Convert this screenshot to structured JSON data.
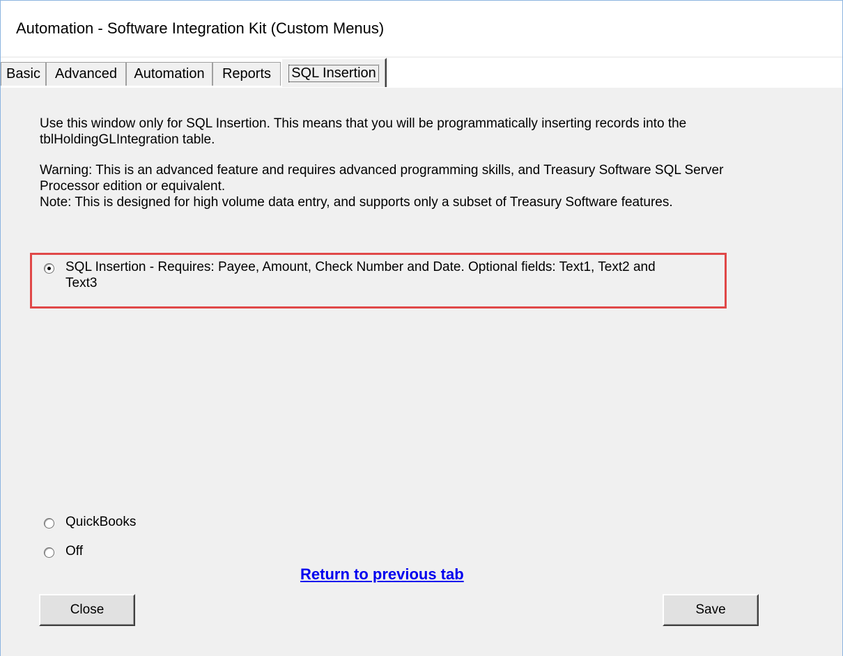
{
  "window": {
    "title": "Automation - Software Integration Kit (Custom Menus)"
  },
  "tabs": [
    {
      "label": "Basic"
    },
    {
      "label": "Advanced"
    },
    {
      "label": "Automation"
    },
    {
      "label": "Reports"
    },
    {
      "label": "SQL Insertion",
      "active": true
    }
  ],
  "content": {
    "intro_line1": "Use this window only for SQL Insertion.  This means that you will be programmatically inserting records into the",
    "intro_line2": "tblHoldingGLIntegration table.",
    "warning_line1": "Warning: This is an advanced feature and requires advanced programming skills, and Treasury Software SQL Server",
    "warning_line2": "Processor edition or equivalent.",
    "note": "Note: This is designed for high volume data entry, and supports only a subset of Treasury Software features."
  },
  "options": {
    "sql_insertion_line1": "SQL Insertion - Requires: Payee, Amount, Check Number and Date. Optional fields: Text1, Text2 and",
    "sql_insertion_line2": "Text3",
    "quickbooks": "QuickBooks",
    "off": "Off",
    "selected": "sql_insertion"
  },
  "link": {
    "return_label": "Return to previous tab"
  },
  "buttons": {
    "close": "Close",
    "save": "Save"
  },
  "colors": {
    "highlight_border": "#e04848",
    "link": "#0000ee",
    "panel_bg": "#f0f0f0"
  }
}
